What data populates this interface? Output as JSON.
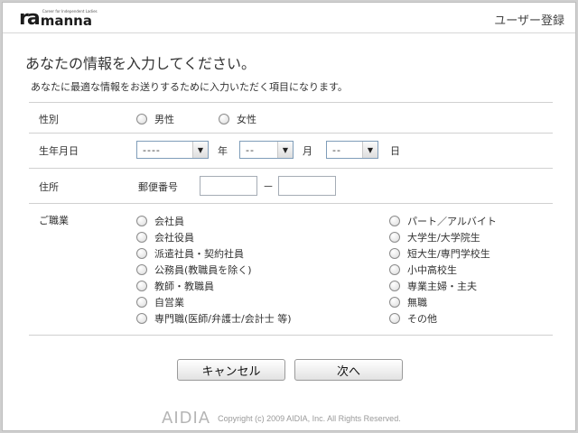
{
  "header": {
    "logo_mark": "ra",
    "logo_name": "manna",
    "logo_tagline": "Career for Independent Ladies",
    "title": "ユーザー登録"
  },
  "intro": {
    "title": "あなたの情報を入力してください。",
    "subtitle": "あなたに最適な情報をお送りするために入力いただく項目になります。"
  },
  "gender": {
    "label": "性別",
    "options": [
      "男性",
      "女性"
    ]
  },
  "birthdate": {
    "label": "生年月日",
    "year_value": "----",
    "year_unit": "年",
    "month_value": "--",
    "month_unit": "月",
    "day_value": "--",
    "day_unit": "日"
  },
  "address": {
    "label": "住所",
    "postal_label": "郵便番号",
    "postal_part1": "",
    "postal_part2": "",
    "separator": "－"
  },
  "occupation": {
    "label": "ご職業",
    "left_options": [
      "会社員",
      "会社役員",
      "派遣社員・契約社員",
      "公務員(教職員を除く)",
      "教師・教職員",
      "自営業",
      "専門職(医師/弁護士/会計士 等)"
    ],
    "right_options": [
      "パート／アルバイト",
      "大学生/大学院生",
      "短大生/専門学校生",
      "小中高校生",
      "専業主婦・主夫",
      "無職",
      "その他"
    ]
  },
  "buttons": {
    "cancel": "キャンセル",
    "next": "次へ"
  },
  "footer": {
    "brand": "AIDIA",
    "copyright": "Copyright (c) 2009 AIDIA, Inc. All Rights Reserved."
  }
}
